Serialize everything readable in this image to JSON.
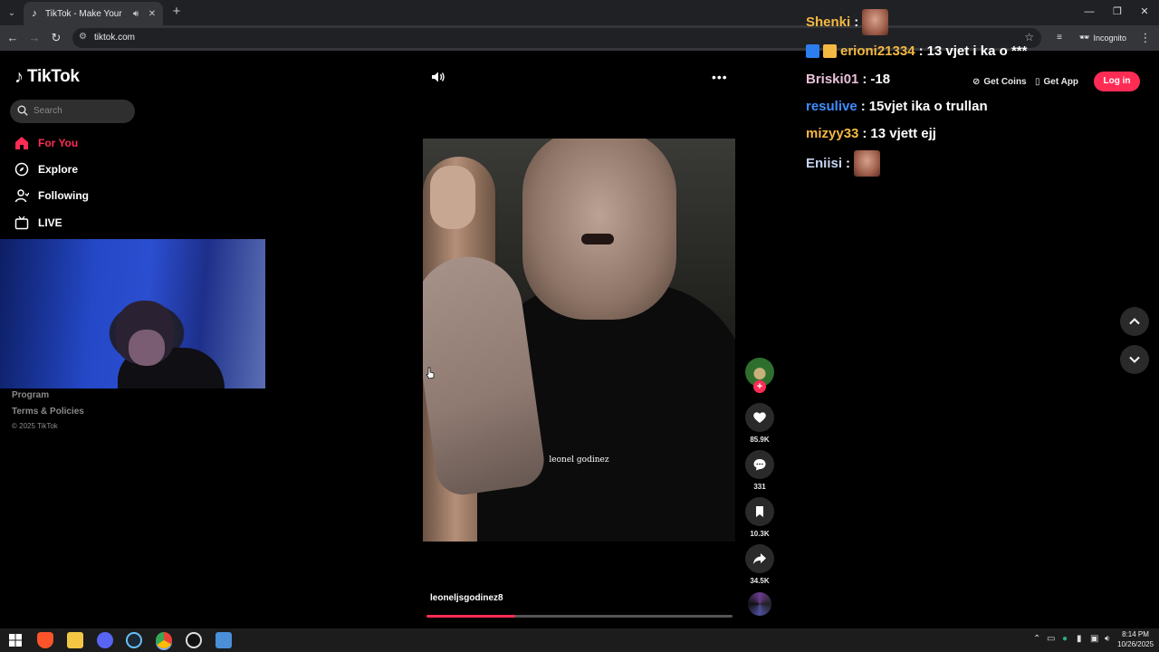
{
  "browser": {
    "tab_title": "TikTok - Make Your Day",
    "url": "tiktok.com",
    "incognito_label": "Incognito"
  },
  "sidebar": {
    "logo_text": "TikTok",
    "search_placeholder": "Search",
    "nav": [
      {
        "label": "For You",
        "icon": "home-icon",
        "active": true
      },
      {
        "label": "Explore",
        "icon": "compass-icon",
        "active": false
      },
      {
        "label": "Following",
        "icon": "following-icon",
        "active": false
      },
      {
        "label": "LIVE",
        "icon": "live-icon",
        "active": false
      }
    ],
    "footer_links": [
      "Program",
      "Terms & Policies"
    ],
    "copyright": "© 2025 TikTok"
  },
  "header": {
    "get_coins": "Get Coins",
    "get_app": "Get App",
    "login": "Log in"
  },
  "video": {
    "caption_overlay": "leonel godinez",
    "author": "leoneljsgodinez8",
    "progress": 0.29,
    "likes": "85.9K",
    "comments": "331",
    "saves": "10.3K",
    "shares": "34.5K"
  },
  "chat": [
    {
      "user": "Shenki",
      "sep": ":",
      "message": "",
      "color": "#f5b843",
      "emote": true
    },
    {
      "user": "erioni21334",
      "sep": ":",
      "message": "13 vjet i ka o ***",
      "color": "#f5b843",
      "emote": false
    },
    {
      "user": "Briski01",
      "sep": ":",
      "message": "-18",
      "color": "#e8c0d8",
      "emote": false
    },
    {
      "user": "resulive",
      "sep": ":",
      "message": "15vjet ika o trullan",
      "color": "#3f8dff",
      "emote": false
    },
    {
      "user": "mizyy33",
      "sep": ":",
      "message": "13 vjett ejj",
      "color": "#f5b843",
      "emote": false
    },
    {
      "user": "Eniisi",
      "sep": ":",
      "message": "",
      "color": "#c7d3ee",
      "emote": true
    }
  ],
  "taskbar": {
    "time": "8:14 PM",
    "date": "10/26/2025"
  },
  "colors": {
    "accent": "#fe2c55",
    "background": "#000000"
  }
}
